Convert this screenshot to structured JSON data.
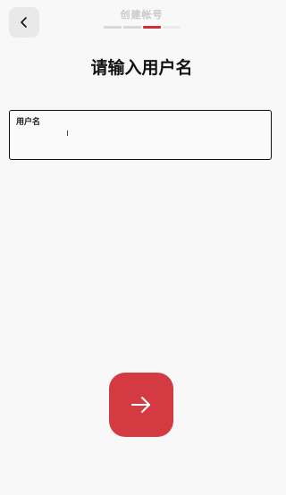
{
  "header": {
    "back_icon": "chevron-left-icon",
    "title": "创建帐号",
    "steps": {
      "total": 4,
      "current": 3
    }
  },
  "main": {
    "title": "请输入用户名",
    "username": {
      "label": "用户名",
      "value": "",
      "placeholder": ""
    }
  },
  "next_button": {
    "icon": "arrow-right-icon"
  },
  "colors": {
    "accent": "#d43a41",
    "step_active": "#c9303a",
    "background": "#f8f8f8"
  }
}
